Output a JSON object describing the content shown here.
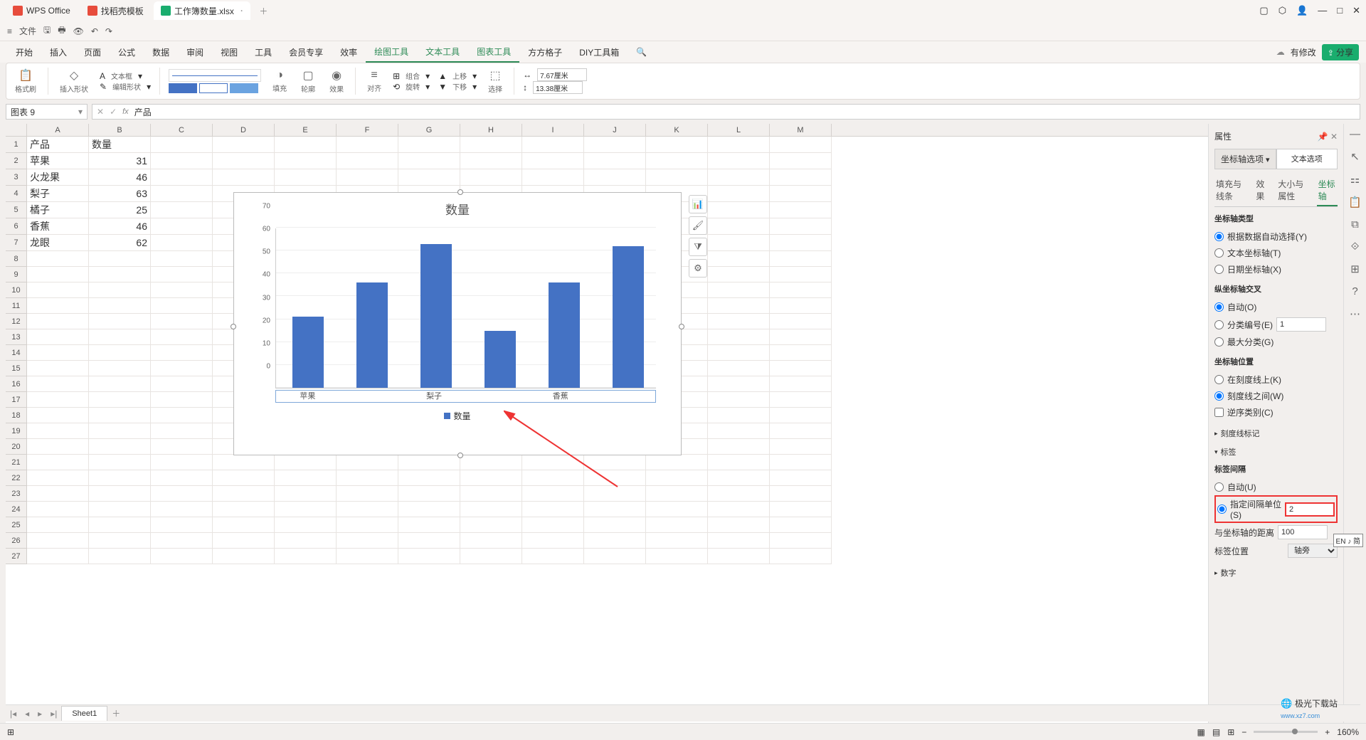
{
  "app": {
    "name": "WPS Office",
    "templates_tab": "找稻壳模板",
    "file_tab": "工作簿数量.xlsx"
  },
  "menu": {
    "file": "文件"
  },
  "tabs": [
    "开始",
    "插入",
    "页面",
    "公式",
    "数据",
    "审阅",
    "视图",
    "工具",
    "会员专享",
    "效率",
    "绘图工具",
    "文本工具",
    "图表工具",
    "方方格子",
    "DIY工具箱"
  ],
  "topright": {
    "mod": "有修改",
    "share": "分享"
  },
  "ribbon": {
    "fmtbrush": "格式刷",
    "insertshape": "插入形状",
    "textbox": "文本框",
    "editshape": "编辑形状",
    "fill": "填充",
    "outline": "轮廓",
    "effect": "效果",
    "align": "对齐",
    "group": "组合",
    "rotate": "旋转",
    "up": "上移",
    "down": "下移",
    "select": "选择",
    "w": "7.67厘米",
    "h": "13.38厘米"
  },
  "namebox": "图表 9",
  "formula": "产品",
  "cols": [
    "A",
    "B",
    "C",
    "D",
    "E",
    "F",
    "G",
    "H",
    "I",
    "J",
    "K",
    "L",
    "M"
  ],
  "data_rows": [
    {
      "a": "产品",
      "b": "数量"
    },
    {
      "a": "苹果",
      "b": "31"
    },
    {
      "a": "火龙果",
      "b": "46"
    },
    {
      "a": "梨子",
      "b": "63"
    },
    {
      "a": "橘子",
      "b": "25"
    },
    {
      "a": "香蕉",
      "b": "46"
    },
    {
      "a": "龙眼",
      "b": "62"
    }
  ],
  "chart_data": {
    "type": "bar",
    "title": "数量",
    "categories": [
      "苹果",
      "火龙果",
      "梨子",
      "橘子",
      "香蕉",
      "龙眼"
    ],
    "values": [
      31,
      46,
      63,
      25,
      46,
      62
    ],
    "x_visible_labels": [
      "苹果",
      "梨子",
      "香蕉"
    ],
    "ylim": [
      0,
      70
    ],
    "ytick": 10,
    "legend": "数量"
  },
  "props": {
    "title": "属性",
    "opt1": "坐标轴选项",
    "opt2": "文本选项",
    "subtabs": [
      "填充与线条",
      "效果",
      "大小与属性",
      "坐标轴"
    ],
    "axis_type": {
      "h": "坐标轴类型",
      "o1": "根据数据自动选择(Y)",
      "o2": "文本坐标轴(T)",
      "o3": "日期坐标轴(X)"
    },
    "vcross": {
      "h": "纵坐标轴交叉",
      "o1": "自动(O)",
      "o2": "分类编号(E)",
      "val": "1",
      "o3": "最大分类(G)"
    },
    "axis_pos": {
      "h": "坐标轴位置",
      "o1": "在刻度线上(K)",
      "o2": "刻度线之间(W)",
      "c1": "逆序类别(C)"
    },
    "tickmark": "刻度线标记",
    "label": {
      "h": "标签",
      "interval": "标签间隔",
      "o1": "自动(U)",
      "o2": "指定间隔单位(S)",
      "val": "2",
      "dist": "与坐标轴的距离",
      "dist_val": "100",
      "pos": "标签位置",
      "pos_val": "轴旁"
    },
    "number": "数字"
  },
  "sheet_tab": "Sheet1",
  "status": {
    "zoom": "160%",
    "ime": "EN ♪ 简"
  },
  "watermark": {
    "t": "极光下载站",
    "u": "www.xz7.com"
  }
}
